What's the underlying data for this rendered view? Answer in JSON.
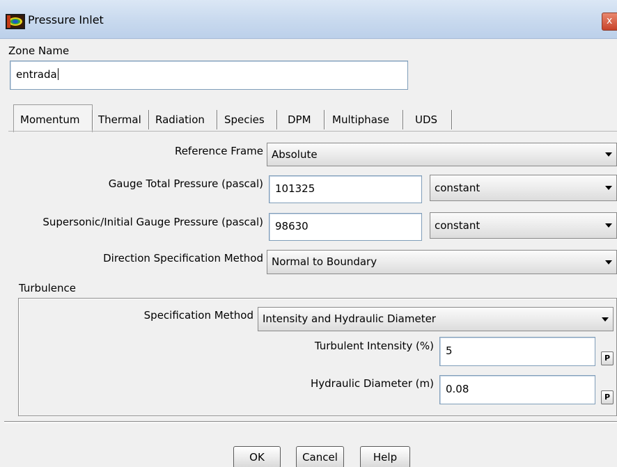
{
  "window": {
    "title": "Pressure Inlet",
    "close_glyph": "x"
  },
  "zone": {
    "label": "Zone Name",
    "value": "entrada"
  },
  "tabs": [
    {
      "label": "Momentum",
      "active": true
    },
    {
      "label": "Thermal",
      "active": false
    },
    {
      "label": "Radiation",
      "active": false
    },
    {
      "label": "Species",
      "active": false
    },
    {
      "label": "DPM",
      "active": false
    },
    {
      "label": "Multiphase",
      "active": false
    },
    {
      "label": "UDS",
      "active": false
    }
  ],
  "momentum": {
    "reference_frame": {
      "label": "Reference Frame",
      "value": "Absolute"
    },
    "gauge_total_pressure": {
      "label": "Gauge Total Pressure (pascal)",
      "value": "101325",
      "profile": "constant"
    },
    "supersonic_pressure": {
      "label": "Supersonic/Initial Gauge Pressure (pascal)",
      "value": "98630",
      "profile": "constant"
    },
    "direction_method": {
      "label": "Direction Specification Method",
      "value": "Normal to Boundary"
    }
  },
  "turbulence": {
    "group_label": "Turbulence",
    "spec_method": {
      "label": "Specification Method",
      "value": "Intensity and Hydraulic Diameter"
    },
    "intensity": {
      "label": "Turbulent Intensity (%)",
      "value": "5",
      "param_button": "P"
    },
    "diameter": {
      "label": "Hydraulic Diameter (m)",
      "value": "0.08",
      "param_button": "P"
    }
  },
  "buttons": {
    "ok": "OK",
    "cancel": "Cancel",
    "help": "Help"
  },
  "icons": {
    "app": "fluent-app-icon",
    "close": "close-icon",
    "dropdown": "chevron-down-icon"
  }
}
